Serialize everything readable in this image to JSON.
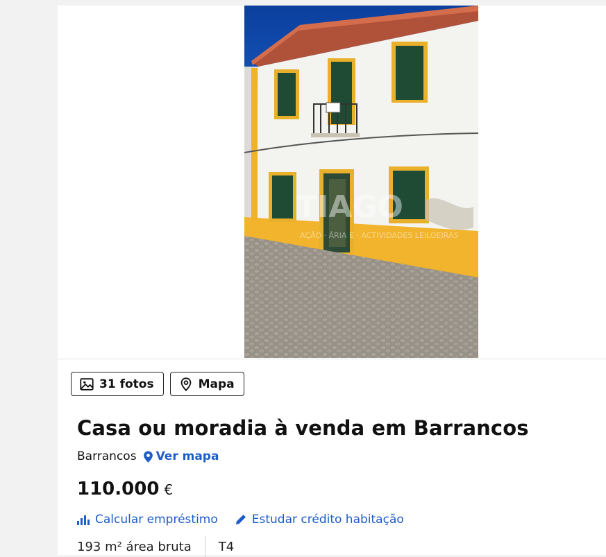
{
  "gallery": {
    "photo_alt": "Fachada da casa",
    "watermark": "TIAGO",
    "watermark_sub": "AÇÃO · ÁRIA E · ACTIVIDADES LEILOEIRAS",
    "photos_button": "31 fotos",
    "map_button": "Mapa"
  },
  "listing": {
    "title": "Casa ou moradia à venda em Barrancos",
    "location": "Barrancos",
    "map_link": "Ver mapa",
    "price": "110.000",
    "currency": "€",
    "loan_link": "Calcular empréstimo",
    "credit_link": "Estudar crédito habitação",
    "area": "193 m² área bruta",
    "typology": "T4"
  },
  "colors": {
    "link_blue": "#1e5cc6",
    "text": "#111111",
    "page_bg": "#f2f2f2"
  }
}
